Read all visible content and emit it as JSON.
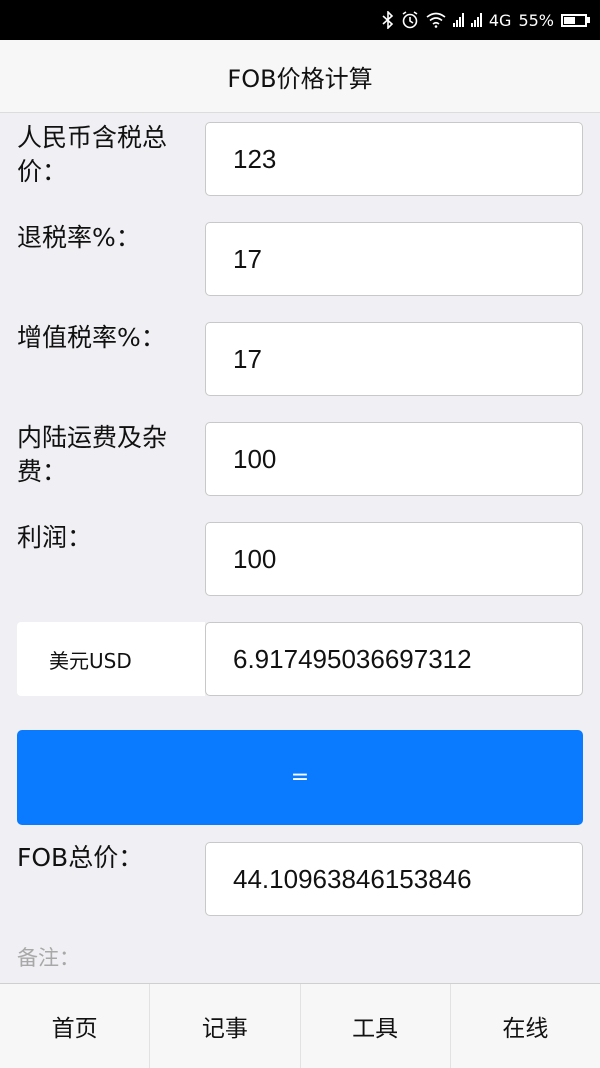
{
  "status_bar": {
    "network": "4G",
    "battery": "55%",
    "battery_level": 0.55,
    "icons": [
      "bluetooth-icon",
      "alarm-icon",
      "wifi-icon",
      "signal-icon",
      "signal-icon",
      "battery-icon"
    ]
  },
  "header": {
    "title": "FOB价格计算"
  },
  "form": {
    "rmb_total": {
      "label": "人民币含税总价：",
      "value": "123"
    },
    "rebate_rate": {
      "label": "退税率%：",
      "value": "17"
    },
    "vat_rate": {
      "label": "增值税率%：",
      "value": "17"
    },
    "inland_fee": {
      "label": "内陆运费及杂费：",
      "value": "100"
    },
    "profit": {
      "label": "利润：",
      "value": "100"
    },
    "exchange": {
      "currency": "美元USD",
      "value": "6.917495036697312"
    },
    "calculate_label": "=",
    "fob_total": {
      "label": "FOB总价：",
      "value": "44.10963846153846"
    },
    "note_label": "备注："
  },
  "bottom_nav": {
    "items": [
      {
        "label": "首页"
      },
      {
        "label": "记事"
      },
      {
        "label": "工具"
      },
      {
        "label": "在线"
      }
    ]
  },
  "colors": {
    "accent": "#0a7bff",
    "background": "#f0f0f4"
  }
}
